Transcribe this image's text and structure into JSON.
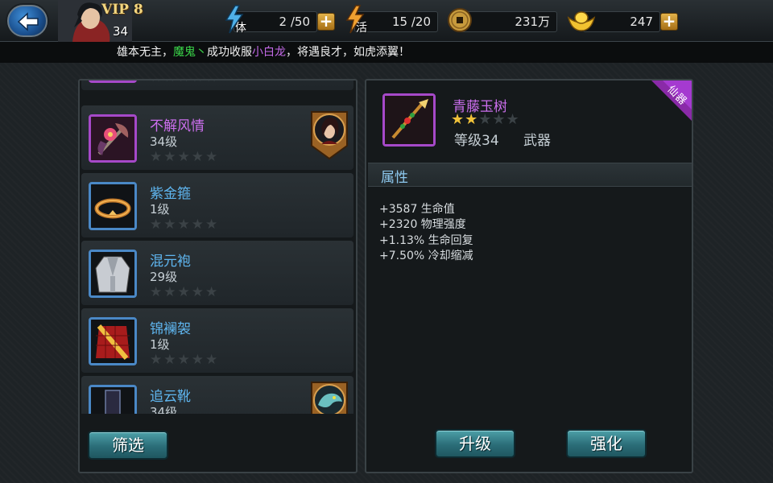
{
  "topbar": {
    "vip": "VIP 8",
    "player_level": "34",
    "stamina": {
      "icon_label": "体",
      "value": "2 /50"
    },
    "energy": {
      "icon_label": "活",
      "value": "15 /20"
    },
    "coins": {
      "value": "231万"
    },
    "gold": {
      "value": "247"
    },
    "plus": "+"
  },
  "announcement": {
    "part1": "雄本无主，",
    "part2": "魔鬼丶",
    "part3": "成功收服",
    "part4": "小白龙",
    "part5": "，将遇良才，如虎添翼！"
  },
  "items": [
    {
      "name": "不解风情",
      "level": "34级",
      "stars": "★★★★★",
      "quality": "purple",
      "icon": "flower-axe-icon",
      "badge": "hero-portrait-icon"
    },
    {
      "name": "紫金箍",
      "level": "1级",
      "stars": "★★★★★",
      "quality": "blue",
      "icon": "golden-ring-icon"
    },
    {
      "name": "混元袍",
      "level": "29级",
      "stars": "★★★★★",
      "quality": "blue",
      "icon": "robe-icon"
    },
    {
      "name": "锦襕袈",
      "level": "1级",
      "stars": "★★★★★",
      "quality": "blue",
      "icon": "kasaya-icon"
    },
    {
      "name": "追云靴",
      "level": "34级",
      "stars": "★★★★★",
      "quality": "blue",
      "icon": "boots-icon",
      "badge": "dragon-portrait-icon"
    }
  ],
  "filter_button": "筛选",
  "detail": {
    "name": "青藤玉树",
    "stars_filled": "★★",
    "stars_empty": "★★★",
    "level": "等级34",
    "type": "武器",
    "ribbon": "仙器",
    "attributes_title": "属性",
    "attributes": [
      "+3587 生命值",
      "+2320 物理强度",
      "+1.13% 生命回复",
      "+7.50% 冷却缩减"
    ]
  },
  "buttons": {
    "upgrade": "升级",
    "enhance": "强化"
  },
  "colors": {
    "purple_quality": "#cc6fee",
    "blue_quality": "#5fb6f0",
    "accent_button": "#2b6d78"
  }
}
